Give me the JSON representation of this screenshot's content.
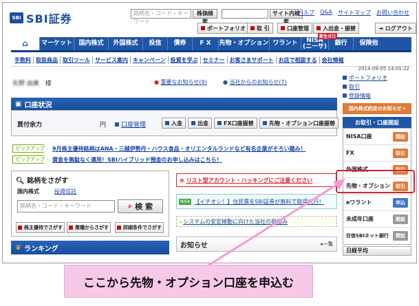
{
  "logo": {
    "mark": "SBI",
    "text": "SBI証券"
  },
  "search": {
    "placeholder": "銘柄名・コード・キーワード",
    "button": "株価検索",
    "site_button": "サイト内検索"
  },
  "top_links": [
    "ヘルプ",
    "Q&A",
    "サイトマップ",
    "お問い合わせ"
  ],
  "utility": {
    "portfolio": "ポートフォリオ",
    "trade": "取 引",
    "account": "口座管理",
    "deposit": "入出金・振替",
    "logout": "ログアウト"
  },
  "nav": [
    "マーケット",
    "国内株式",
    "外国株式",
    "投信",
    "債券",
    "F X",
    "先物・オプション",
    "ワラント",
    "NISA\n(ニーサ)",
    "銀行",
    "保険他"
  ],
  "nav_badge": "新生ゼロ",
  "subnav": [
    "手数料",
    "取扱商品",
    "取引ツール",
    "サービス案内",
    "キャンペーン",
    "投資を学ぶ",
    "セミナー",
    "お客さまサポート",
    "お店で相談する",
    "会社情報"
  ],
  "datetime": "2014-09-05 14:01:22",
  "user": {
    "name": "矢野 由美",
    "suffix": "様"
  },
  "notices": {
    "important": "重要なお知らせ(9)",
    "from_company": "当社からのお知らせ(7)"
  },
  "account_status": {
    "title": "口座状況",
    "label": "買付余力",
    "unit": "円",
    "mgmt": "口座管理",
    "buttons": [
      "入金",
      "出金",
      "FX口座振替",
      "先物・オプション口座振替"
    ]
  },
  "pickups": [
    {
      "tag": "ピックアップ",
      "text": "9月株主優待銘柄はANA・三越伊勢丹・ハウス食品・オリエンタルランドなど有名企業がそろい踏み！"
    },
    {
      "tag": "ピックアップ",
      "text": "資金を無駄なく運用！SBIハイブリッド預金のお申し込みはこちら！"
    }
  ],
  "stock_search": {
    "title": "銘柄をさがす",
    "tab_active": "国内株式",
    "tab_other": "投資信託",
    "placeholder": "銘柄名・コード・キーワード",
    "button": "検 索",
    "filters": [
      "株主優待でさがす",
      "業種からさがす",
      "詳細条件でさがす"
    ]
  },
  "ranking": {
    "title": "ランキング"
  },
  "alerts": {
    "risk": "リスト型アカウント・ハッキングにご注意ください",
    "nisa_badge": "NISA",
    "campaign": "【イチオシ！】住民票をSBI証券が無料で取得代行！",
    "system": "システムの安定稼動に向けた当社の取組み"
  },
  "oshirase": {
    "title": "お知らせ",
    "more": "一覧"
  },
  "right_panel": {
    "links": [
      "ポートフォリオ",
      "取引",
      "登録情報"
    ],
    "promo": "国内株式約定のお知らせ",
    "section_title": "お取引・口座開設",
    "rows": [
      {
        "label": "NISA口座",
        "action": "開設",
        "style": "orange"
      },
      {
        "label": "FX",
        "action": "取引",
        "style": "orange"
      },
      {
        "label": "外国株式",
        "action": "取引",
        "style": "orange"
      },
      {
        "label": "先物・オプション",
        "action": "取引",
        "style": "orange"
      },
      {
        "label": "eワラント",
        "action": "申込",
        "style": "blue"
      },
      {
        "label": "未成年口座",
        "action": "開設",
        "style": "gray"
      },
      {
        "label": "住信SBIネット銀行",
        "action": "開設",
        "style": "gray"
      }
    ],
    "footer": "日経平均"
  },
  "caption": "ここから先物・オプション口座を申込む",
  "colors": {
    "brand_blue": "#1f55a6",
    "highlight_red": "#d9202a",
    "arrow_pink": "#f59ad6"
  }
}
